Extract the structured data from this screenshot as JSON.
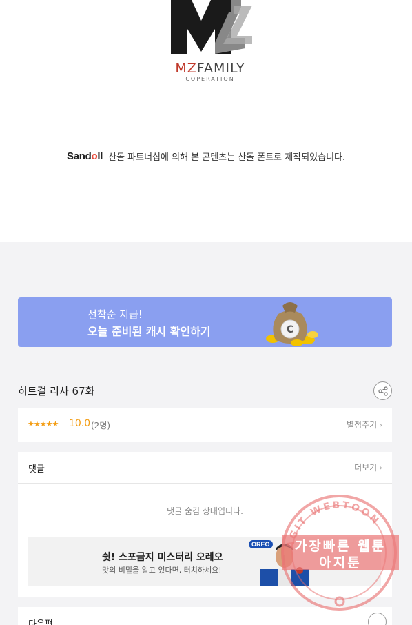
{
  "logo": {
    "name_accent": "MZ",
    "name_rest": "FAMILY",
    "sub": "COPERATION"
  },
  "sandoll": {
    "logo_text_a": "Sand",
    "logo_text_o": "o",
    "logo_text_b": "ll",
    "notice": "산돌 파트너십에 의해 본 콘텐츠는 산돌 폰트로 제작되었습니다."
  },
  "banner": {
    "line1": "선착순 지급!",
    "line2": "오늘 준비된 캐시 확인하기",
    "coin_letter": "C"
  },
  "episode": {
    "title": "히트걸 리사 67화"
  },
  "rating": {
    "stars": "★★★★★",
    "score": "10.0",
    "count": "(2명)",
    "rate_label": "별점주기",
    "chevron": "›"
  },
  "comments": {
    "title": "댓글",
    "more_label": "더보기",
    "hidden_msg": "댓글 숨김 상태입니다.",
    "ad": {
      "title": "쉿! 스포금지 미스터리 오레오",
      "subtitle": "맛의 비밀을 알고 있다면, 터치하세요!",
      "brand": "OREO"
    }
  },
  "next": {
    "title": "다음편"
  },
  "watermark": {
    "arc_text": "AGIT WEBTOON",
    "line1": "가장빠른 웹툰",
    "line2": "아지툰"
  },
  "icons": {
    "share": "share-icon",
    "next": "drop-icon",
    "chevron": "chevron-right-icon"
  },
  "colors": {
    "banner": "#8a9ff0",
    "rating_accent": "#f39c12",
    "watermark": "#e86a6a"
  }
}
